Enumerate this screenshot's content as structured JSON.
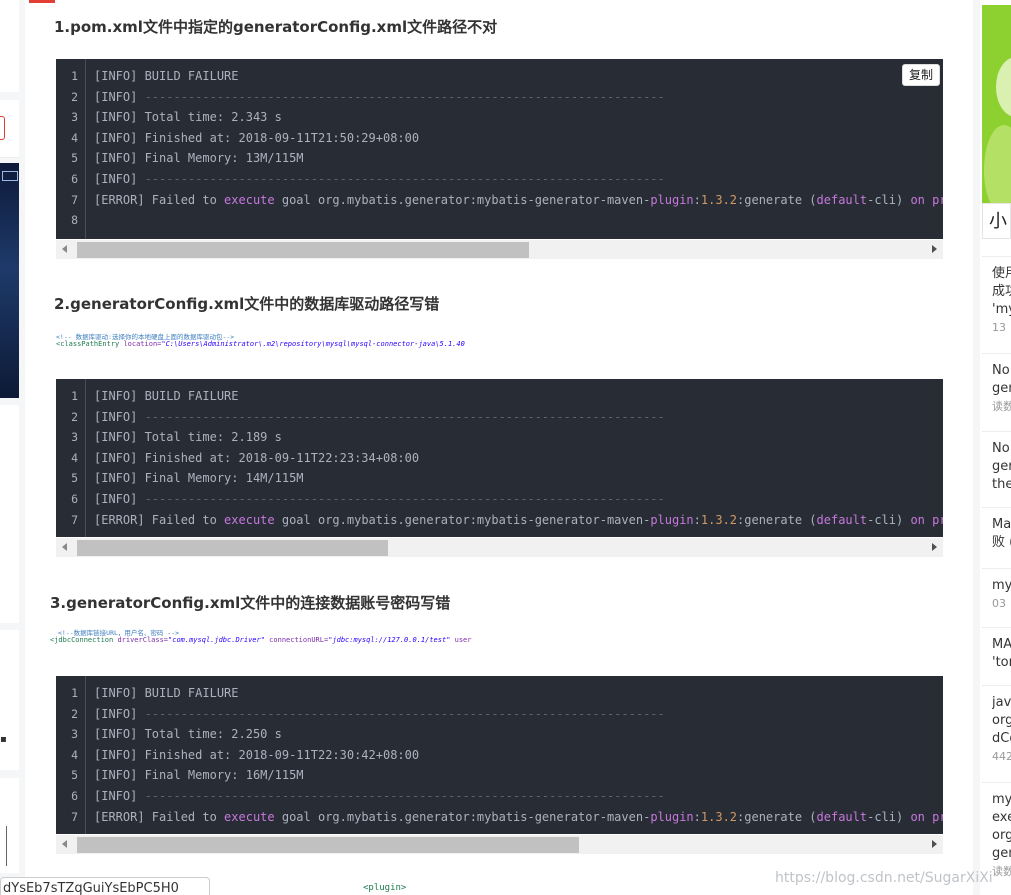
{
  "sections": [
    {
      "title": "1.pom.xml文件中指定的generatorConfig.xml文件路径不对"
    },
    {
      "title": "2.generatorConfig.xml文件中的数据库驱动路径写错"
    },
    {
      "title": "3.generatorConfig.xml文件中的连接数据账号密码写错"
    }
  ],
  "copy_label": "复制",
  "code_blocks": [
    {
      "lines": [
        "[INFO] BUILD FAILURE",
        "[INFO] ------------------------------------------------------------------------",
        "[INFO] Total time: 2.343 s",
        "[INFO] Finished at: 2018-09-11T21:50:29+08:00",
        "[INFO] Final Memory: 13M/115M",
        "[INFO] ------------------------------------------------------------------------",
        "[ERROR] Failed to execute goal org.mybatis.generator:mybatis-generator-maven-plugin:1.3.2:generate (default-cli) on pr",
        ""
      ],
      "line_numbers": [
        "1",
        "2",
        "3",
        "4",
        "5",
        "6",
        "7",
        "8"
      ],
      "scroll_fraction": 0.5
    },
    {
      "lines": [
        "[INFO] BUILD FAILURE",
        "[INFO] ------------------------------------------------------------------------",
        "[INFO] Total time: 2.189 s",
        "[INFO] Finished at: 2018-09-11T22:23:34+08:00",
        "[INFO] Final Memory: 14M/115M",
        "[INFO] ------------------------------------------------------------------------",
        "[ERROR] Failed to execute goal org.mybatis.generator:mybatis-generator-maven-plugin:1.3.2:generate (default-cli) on pr"
      ],
      "line_numbers": [
        "1",
        "2",
        "3",
        "4",
        "5",
        "6",
        "7"
      ],
      "scroll_fraction": 0.3
    },
    {
      "lines": [
        "[INFO] BUILD FAILURE",
        "[INFO] ------------------------------------------------------------------------",
        "[INFO] Total time: 2.250 s",
        "[INFO] Finished at: 2018-09-11T22:30:42+08:00",
        "[INFO] Final Memory: 16M/115M",
        "[INFO] ------------------------------------------------------------------------",
        "[ERROR] Failed to execute goal org.mybatis.generator:mybatis-generator-maven-plugin:1.3.2:generate (default-cli) on pr"
      ],
      "line_numbers": [
        "1",
        "2",
        "3",
        "4",
        "5",
        "6",
        "7"
      ],
      "scroll_fraction": 0.5
    }
  ],
  "snippets": {
    "s1_comment": "<!-- 数据库驱动:选择你的本地硬盘上面的数据库驱动包-->",
    "s1_code_tag": "<classPathEntry",
    "s1_code_attr": "location=",
    "s1_code_val": "\"C:\\Users\\Administrator\\.m2\\repository\\mysql\\mysql-connector-java\\5.1.40",
    "s2_comment": "<!--数据库链接URL，用户名、密码 -->",
    "s2_code_tag": "<jdbcConnection",
    "s2_code_attr1": "driverClass=",
    "s2_code_val1": "\"com.mysql.jdbc.Driver\"",
    "s2_code_attr2": "connectionURL=",
    "s2_code_val2": "\"jdbc:mysql://127.0.0.1/test\"",
    "s2_code_attr3": "user"
  },
  "sidebar": {
    "title": "小",
    "items": [
      {
        "l1": "使用",
        "l2": "成功",
        "l3": "'my",
        "meta": "13"
      },
      {
        "l1": "No",
        "l2": "gen",
        "meta": "读数"
      },
      {
        "l1": "No",
        "l2": "gen",
        "l3": "the"
      },
      {
        "l1": "Ma",
        "l2": "败 ("
      },
      {
        "l1": "my",
        "meta": "03"
      },
      {
        "l1": "MA",
        "l2": "'tor"
      },
      {
        "l1": "java",
        "l2": "org",
        "l3": "dCo",
        "meta": "442"
      },
      {
        "l1": "my",
        "l2": "exe",
        "l3": "org",
        "l4": "gen",
        "meta": "读数"
      }
    ]
  },
  "bottom_tab": "dYsEb7sTZqGuiYsEbPC5H0",
  "plugin_text": "<plugin>",
  "watermark": "https://blog.csdn.net/SugarXiXi"
}
